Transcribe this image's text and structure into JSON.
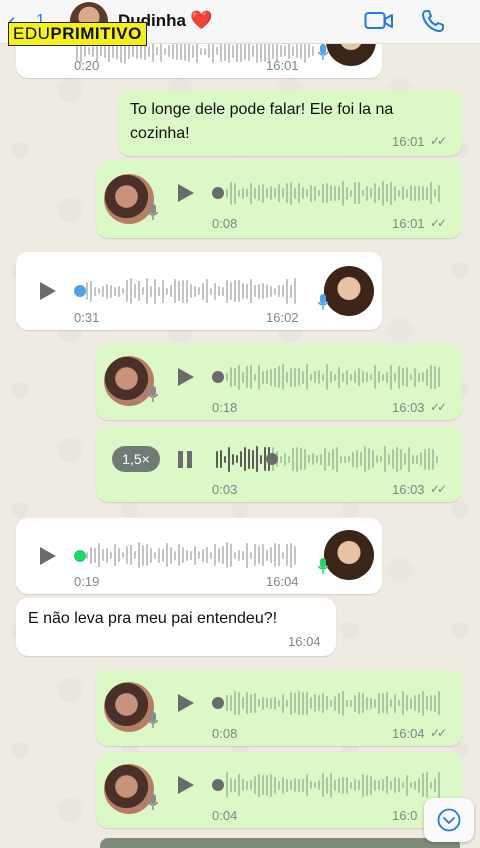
{
  "header": {
    "back_count": "1",
    "contact_name": "Dudinha",
    "heart": "❤️",
    "watermark_a": "EDU",
    "watermark_b": "PRIMITIVO"
  },
  "colors": {
    "outgoing_bubble": "#dcf8c6",
    "incoming_bubble": "#ffffff",
    "accent_blue": "#1f7aec",
    "played_dot_blue": "#4fa3e8",
    "played_dot_green": "#25d366"
  },
  "messages": [
    {
      "type": "voice",
      "direction": "in",
      "duration": "0:20",
      "time": "16:01"
    },
    {
      "type": "text",
      "direction": "out",
      "line1": "To longe dele pode falar! Ele foi la na",
      "line2": "cozinha!",
      "time": "16:01",
      "ticks": "✓✓"
    },
    {
      "type": "voice",
      "direction": "out",
      "duration": "0:08",
      "time": "16:01",
      "ticks": "✓✓"
    },
    {
      "type": "voice",
      "direction": "in",
      "duration": "0:31",
      "time": "16:02"
    },
    {
      "type": "voice",
      "direction": "out",
      "duration": "0:18",
      "time": "16:03",
      "ticks": "✓✓"
    },
    {
      "type": "voice",
      "direction": "out",
      "duration": "0:03",
      "time": "16:03",
      "ticks": "✓✓",
      "speed": "1,5×",
      "progress": 0.25
    },
    {
      "type": "voice",
      "direction": "in",
      "duration": "0:19",
      "time": "16:04"
    },
    {
      "type": "text",
      "direction": "in",
      "line1": "E não leva pra meu pai entendeu?!",
      "time": "16:04"
    },
    {
      "type": "voice",
      "direction": "out",
      "duration": "0:08",
      "time": "16:04",
      "ticks": "✓✓"
    },
    {
      "type": "voice",
      "direction": "out",
      "duration": "0:04",
      "time": "16:0",
      "ticks": ""
    }
  ]
}
